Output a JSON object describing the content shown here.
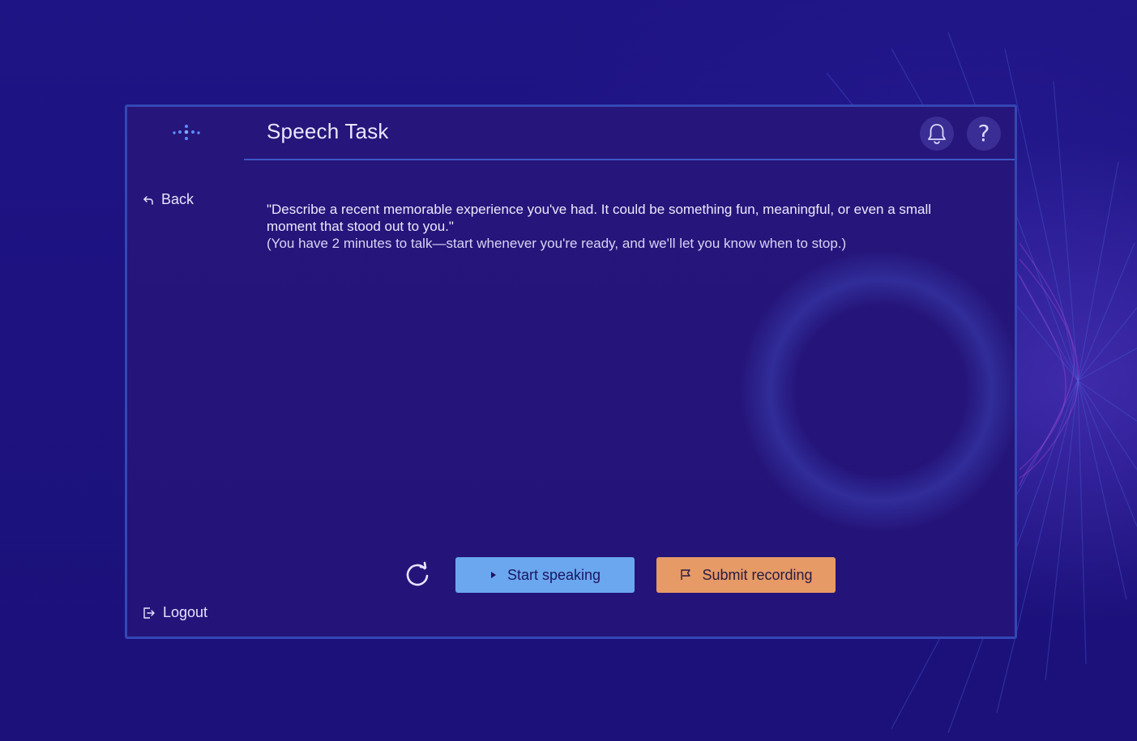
{
  "header": {
    "logo_icon": "dots-logo-icon",
    "title": "Speech Task",
    "notifications_icon": "bell-icon",
    "help_icon": "help-question-icon",
    "help_glyph": "?"
  },
  "sidebar": {
    "back_label": "Back",
    "back_icon": "back-arrow-icon",
    "logout_label": "Logout",
    "logout_icon": "logout-icon"
  },
  "prompt": {
    "text": "\"Describe a recent memorable experience you've had. It could be something fun, meaningful, or even a small moment that stood out to you.\"",
    "note": "(You have 2 minutes to talk—start whenever you're ready, and we'll let you know when to stop.)"
  },
  "controls": {
    "reset_icon": "refresh-icon",
    "start_label": "Start speaking",
    "start_icon": "play-icon",
    "submit_label": "Submit recording",
    "submit_icon": "flag-icon"
  },
  "colors": {
    "background": "#1e1382",
    "panel_border": "#3447b5",
    "start_button": "#6aa7ef",
    "submit_button": "#e69a66"
  }
}
